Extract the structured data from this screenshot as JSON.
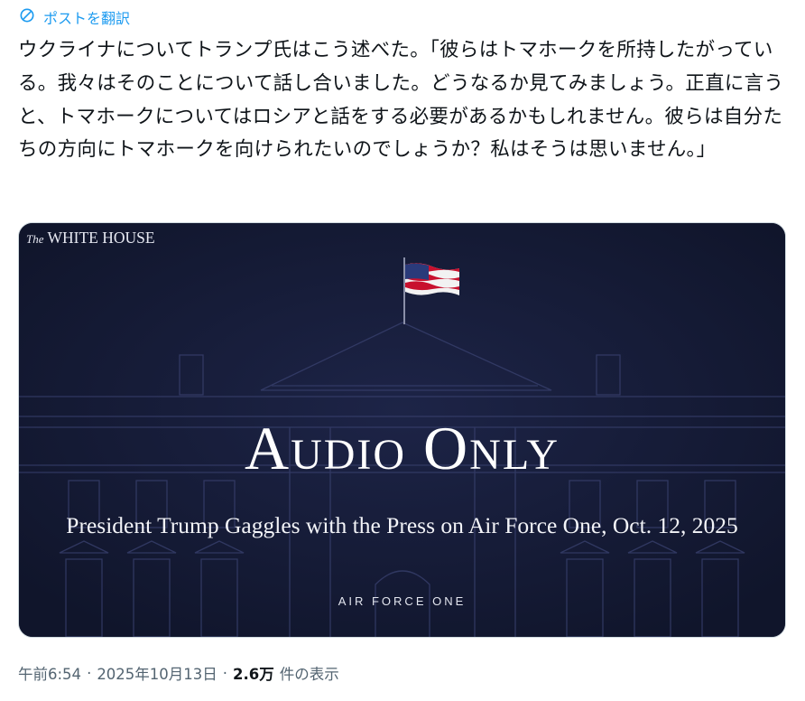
{
  "translate": {
    "label": "ポストを翻訳",
    "icon": "globe-translate-icon"
  },
  "post": {
    "text": "ウクライナについてトランプ氏はこう述べた。「彼らはトマホークを所持したがっている。我々はそのことについて話し合いました。どうなるか見てみましょう。正直に言うと、トマホークについてはロシアと話をする必要があるかもしれません。彼らは自分たちの方向にトマホークを向けられたいのでしょうか？私はそうは思いません。」"
  },
  "card": {
    "brand_the": "The",
    "brand_name": "WHITE HOUSE",
    "headline": "Audio Only",
    "subtitle": "President Trump Gaggles with the Press on Air Force One, Oct. 12, 2025",
    "location": "AIR FORCE ONE",
    "background_color": "#141a33",
    "accent_color": "#ffffff"
  },
  "meta": {
    "time": "午前6:54",
    "separator": "·",
    "date": "2025年10月13日",
    "views_count": "2.6万",
    "views_label": "件の表示"
  },
  "colors": {
    "link": "#1d9bf0",
    "text": "#0f1419",
    "muted": "#536471"
  }
}
